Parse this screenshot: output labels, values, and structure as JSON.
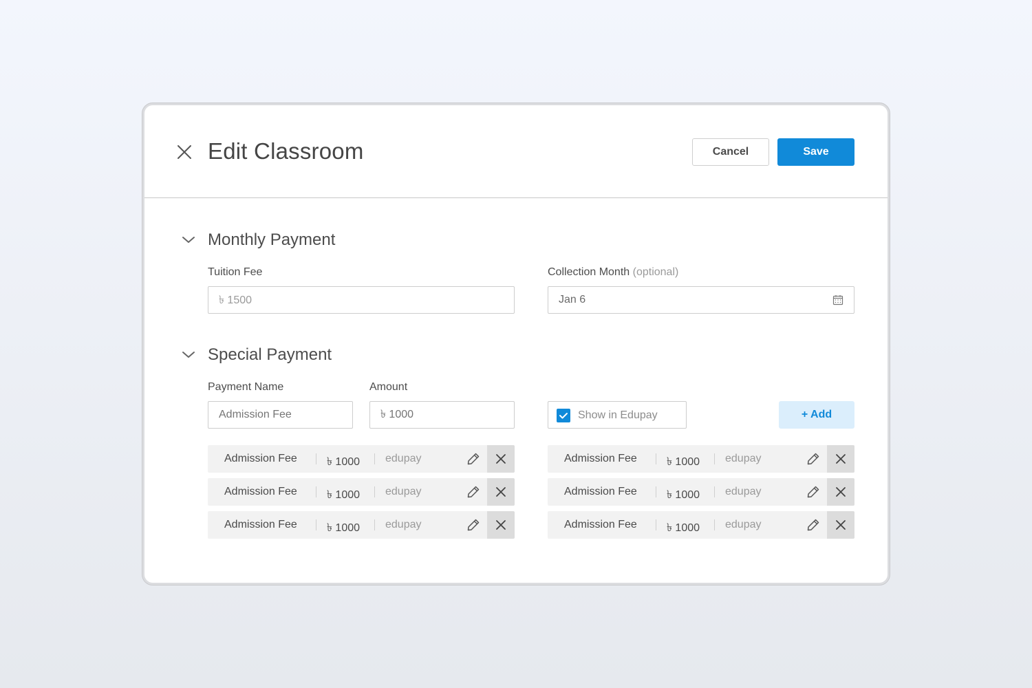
{
  "modal": {
    "title": "Edit Classroom",
    "cancel_label": "Cancel",
    "save_label": "Save"
  },
  "monthly": {
    "section_title": "Monthly Payment",
    "tuition_label": "Tuition Fee",
    "tuition_value": "৳ 1500",
    "collection_label": "Collection Month",
    "collection_optional": "(optional)",
    "collection_value": "Jan 6"
  },
  "special": {
    "section_title": "Special Payment",
    "name_label": "Payment Name",
    "name_placeholder": "Admission Fee",
    "amount_label": "Amount",
    "amount_placeholder": "৳ 1000",
    "show_label": "Show in Edupay",
    "show_checked": true,
    "add_label": "+ Add",
    "items": [
      {
        "name": "Admission Fee",
        "amount": "৳ 1000",
        "source": "edupay"
      },
      {
        "name": "Admission Fee",
        "amount": "৳ 1000",
        "source": "edupay"
      },
      {
        "name": "Admission Fee",
        "amount": "৳ 1000",
        "source": "edupay"
      },
      {
        "name": "Admission Fee",
        "amount": "৳ 1000",
        "source": "edupay"
      },
      {
        "name": "Admission Fee",
        "amount": "৳ 1000",
        "source": "edupay"
      },
      {
        "name": "Admission Fee",
        "amount": "৳ 1000",
        "source": "edupay"
      }
    ]
  },
  "colors": {
    "accent": "#118ad9",
    "accent_light": "#dbeefc",
    "row_bg": "#f2f2f2",
    "delete_bg": "#dcdcdc"
  },
  "icons": [
    "close-icon",
    "chevron-down-icon",
    "calendar-icon",
    "check-icon",
    "pencil-icon",
    "x-icon"
  ]
}
